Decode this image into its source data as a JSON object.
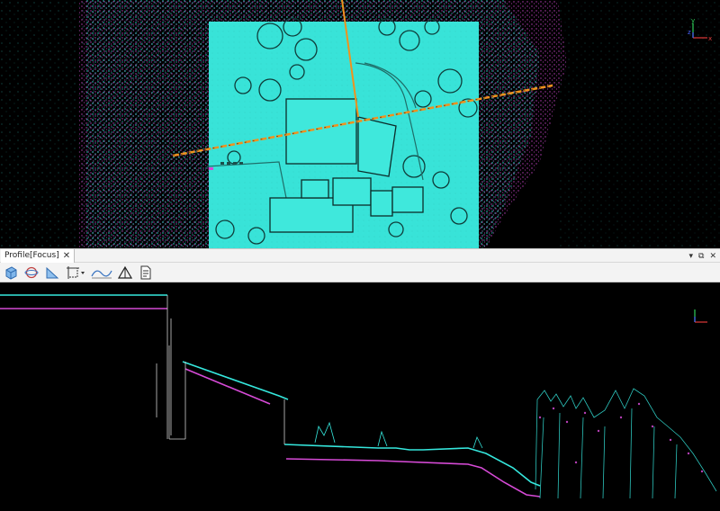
{
  "profile_panel": {
    "tab_title": "Profile[Focus]",
    "tab_close": "✕",
    "controls": {
      "pin": "▾",
      "float": "⧉",
      "close": "✕"
    }
  },
  "toolbar": {
    "tools": [
      {
        "name": "view-3d-icon"
      },
      {
        "name": "rotate-view-icon"
      },
      {
        "name": "measure-slope-icon"
      },
      {
        "name": "select-region-icon"
      },
      {
        "name": "profile-tool-icon"
      },
      {
        "name": "triangle-measure-icon"
      },
      {
        "name": "report-icon"
      }
    ]
  },
  "axis_gizmo": {
    "y": "y",
    "z": "z",
    "x": "x"
  },
  "colors": {
    "cyan": "#35e7dd",
    "magenta": "#d64ad6",
    "orange": "#f0921e",
    "background": "#000000"
  }
}
